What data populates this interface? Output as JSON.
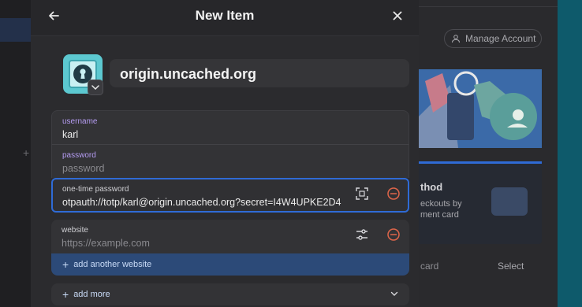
{
  "modal": {
    "title": "New Item",
    "item_name": "origin.uncached.org"
  },
  "fields": {
    "username": {
      "label": "username",
      "value": "karl"
    },
    "password": {
      "label": "password",
      "placeholder": "password"
    },
    "otp": {
      "label": "one-time password",
      "value": "otpauth://totp/karl@origin.uncached.org?secret=I4W4UPKE2D4"
    },
    "website": {
      "label": "website",
      "placeholder": "https://example.com"
    }
  },
  "actions": {
    "add_website": "add another website",
    "add_more": "add more"
  },
  "background": {
    "manage_account": "Manage Account",
    "card_title": "thod",
    "card_text_1": "eckouts by",
    "card_text_2": "ment card",
    "card_label": "card",
    "select_label": "Select"
  },
  "colors": {
    "accent": "#2f6bd6",
    "danger": "#e0664a",
    "label_purple": "#b59cf2",
    "app_icon": "#5cc8d0"
  },
  "icons": {
    "back": "arrow-left-icon",
    "close": "close-icon",
    "app": "keyhole-icon",
    "scan": "qr-scan-icon",
    "remove": "minus-circle-icon",
    "options": "sliders-icon",
    "add": "plus-icon",
    "expand": "chevron-down-icon",
    "drag": "hamburger-icon"
  }
}
